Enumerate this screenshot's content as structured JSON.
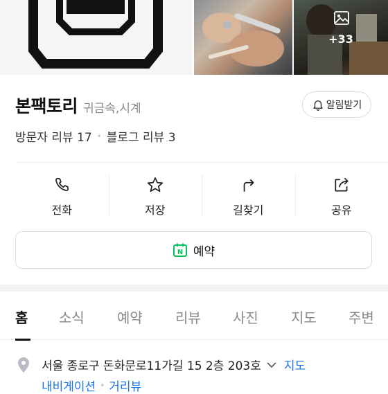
{
  "photos": {
    "more_count": "+33",
    "more_icon": "image-icon"
  },
  "place": {
    "name": "본팩토리",
    "category": "귀금속,시계"
  },
  "alert_button": {
    "label": "알림받기",
    "icon": "bell-icon"
  },
  "reviews": {
    "visitor": "방문자 리뷰 17",
    "blog": "블로그 리뷰 3"
  },
  "actions": [
    {
      "label": "전화",
      "icon": "phone-icon"
    },
    {
      "label": "저장",
      "icon": "star-icon"
    },
    {
      "label": "길찾기",
      "icon": "directions-icon"
    },
    {
      "label": "공유",
      "icon": "share-icon"
    }
  ],
  "reserve_button": {
    "label": "예약",
    "icon": "naver-calendar-icon",
    "icon_letter": "N",
    "accent": "#03c75a"
  },
  "tabs": [
    {
      "label": "홈",
      "active": true
    },
    {
      "label": "소식"
    },
    {
      "label": "예약"
    },
    {
      "label": "리뷰"
    },
    {
      "label": "사진"
    },
    {
      "label": "지도"
    },
    {
      "label": "주변"
    }
  ],
  "address": {
    "text": "서울 종로구 돈화문로11가길 15 2층 203호",
    "map_link": "지도",
    "navigation_link": "내비게이션",
    "street_view_link": "거리뷰"
  },
  "colors": {
    "link": "#1a73e8",
    "naver_green": "#03c75a"
  }
}
